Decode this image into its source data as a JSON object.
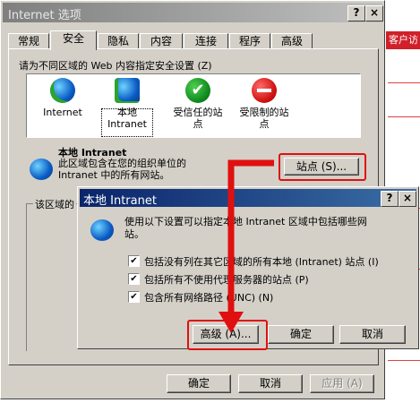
{
  "main_window": {
    "title": "Internet 选项",
    "help_btn": "?",
    "close_btn": "×",
    "tabs": [
      {
        "label": "常规"
      },
      {
        "label": "安全"
      },
      {
        "label": "隐私"
      },
      {
        "label": "内容"
      },
      {
        "label": "连接"
      },
      {
        "label": "程序"
      },
      {
        "label": "高级"
      }
    ],
    "zone_prompt": "请为不同区域的 Web 内容指定安全设置 (Z)",
    "zones": [
      {
        "label": "Internet"
      },
      {
        "label": "本地\nIntranet"
      },
      {
        "label": "受信任的站\n点"
      },
      {
        "label": "受限制的站\n点"
      }
    ],
    "selected_zone": {
      "title": "本地 Intranet",
      "desc": "此区域包含在您的组织单位的\nIntranet 中的所有网站。",
      "sites_button": "站点 (S)..."
    },
    "security_level_label": "该区域的",
    "buttons": {
      "ok": "确定",
      "cancel": "取消",
      "apply": "应用 (A)"
    }
  },
  "dialog": {
    "title": "本地 Intranet",
    "help_btn": "?",
    "close_btn": "×",
    "intro": "使用以下设置可以指定本地 Intranet 区域中包括哪些网\n站。",
    "options": [
      {
        "label": "包括没有列在其它区域的所有本地 (Intranet) 站点 (I)",
        "checked": true
      },
      {
        "label": "包括所有不使用代理服务器的站点 (P)",
        "checked": true
      },
      {
        "label": "包含所有网络路径 (UNC) (N)",
        "checked": true
      }
    ],
    "check_mark": "✔",
    "buttons": {
      "advanced": "高级 (A)...",
      "ok": "确定",
      "cancel": "取消"
    }
  },
  "background_page": {
    "strip_text": "客户访"
  },
  "colors": {
    "highlight": "#e01010",
    "active_title": "#0a246a",
    "inactive_title": "#7f7f7f"
  }
}
